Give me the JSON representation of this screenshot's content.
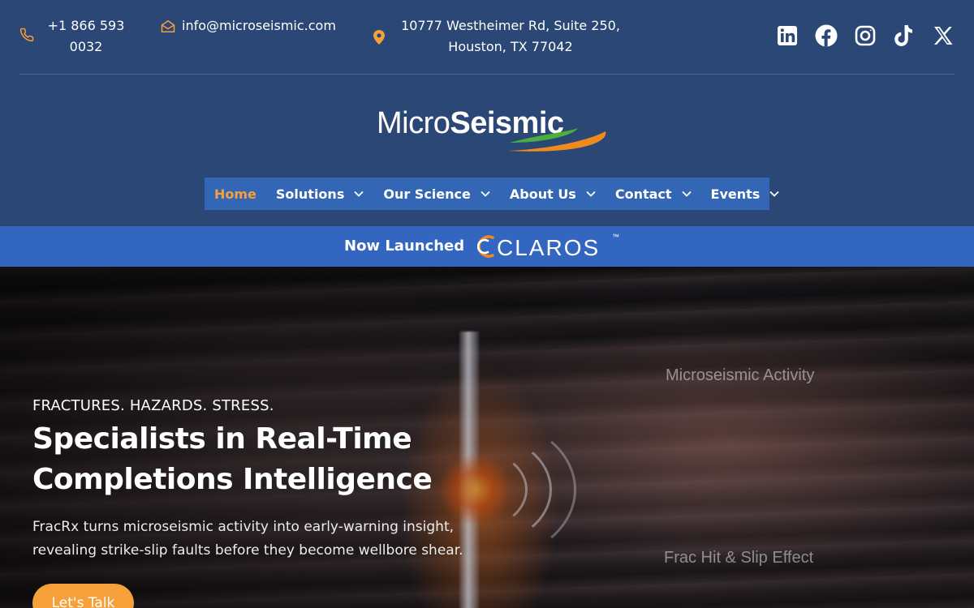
{
  "topbar": {
    "phone": {
      "icon": "phone-icon",
      "text": "+1 866 593 0032"
    },
    "email": {
      "icon": "envelope-icon",
      "text": "info@microseismic.com"
    },
    "address": {
      "icon": "map-pin-icon",
      "text": "10777 Westheimer Rd, Suite 250, Houston, TX 77042"
    },
    "social": [
      {
        "name": "linkedin-icon"
      },
      {
        "name": "facebook-icon"
      },
      {
        "name": "instagram-icon"
      },
      {
        "name": "tiktok-icon"
      },
      {
        "name": "x-icon"
      }
    ],
    "icon_color": "#f5a03a"
  },
  "logo": {
    "part1": "Micro",
    "part2": "Seismic",
    "swoosh_colors": [
      "#4caf3c",
      "#f08a1c"
    ]
  },
  "nav": {
    "items": [
      {
        "label": "Home",
        "active": true,
        "has_dropdown": false
      },
      {
        "label": "Solutions",
        "active": false,
        "has_dropdown": true
      },
      {
        "label": "Our Science",
        "active": false,
        "has_dropdown": true
      },
      {
        "label": "About Us",
        "active": false,
        "has_dropdown": true
      },
      {
        "label": "Contact",
        "active": false,
        "has_dropdown": true
      },
      {
        "label": "Events",
        "active": false,
        "has_dropdown": true
      }
    ],
    "background": "#3366b5",
    "active_color": "#f5a03a"
  },
  "announcement": {
    "label": "Now Launched",
    "product_logo_text": "CLAROS",
    "trademark": "™"
  },
  "hero": {
    "eyebrow": "FRACTURES. HAZARDS. STRESS.",
    "heading": "Specialists in Real-Time Completions Intelligence",
    "lede": "FracRx turns microseismic activity into early-warning insight, revealing strike-slip faults before they become wellbore shear.",
    "cta_label": "Let's Talk",
    "image_labels": [
      "Microseismic Activity",
      "Frac Hit & Slip Effect"
    ]
  }
}
